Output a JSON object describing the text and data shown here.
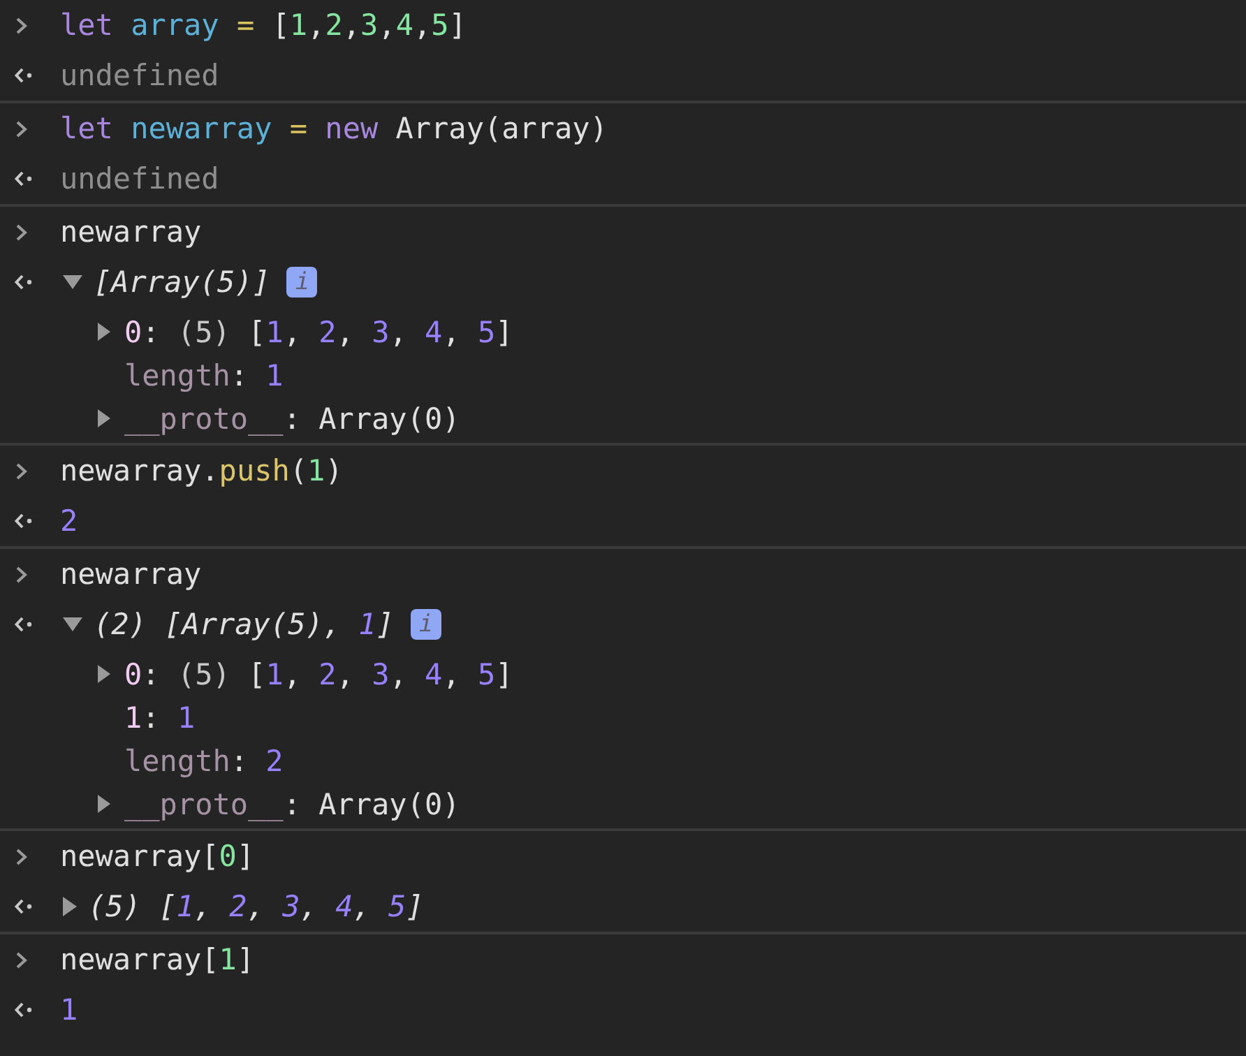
{
  "entries": [
    {
      "input": [
        {
          "t": "let ",
          "kind": "kw"
        },
        {
          "t": "array ",
          "kind": "var"
        },
        {
          "t": "=",
          "kind": "op"
        },
        {
          "t": " [",
          "kind": "plain"
        },
        {
          "t": "1",
          "kind": "lit"
        },
        {
          "t": ",",
          "kind": "plain"
        },
        {
          "t": "2",
          "kind": "lit"
        },
        {
          "t": ",",
          "kind": "plain"
        },
        {
          "t": "3",
          "kind": "lit"
        },
        {
          "t": ",",
          "kind": "plain"
        },
        {
          "t": "4",
          "kind": "lit"
        },
        {
          "t": ",",
          "kind": "plain"
        },
        {
          "t": "5",
          "kind": "lit"
        },
        {
          "t": "]",
          "kind": "plain"
        }
      ],
      "output": {
        "kind": "value",
        "segments": [
          {
            "t": "undefined",
            "kind": "undef"
          }
        ]
      }
    },
    {
      "input": [
        {
          "t": "let ",
          "kind": "kw"
        },
        {
          "t": "newarray ",
          "kind": "var"
        },
        {
          "t": "= ",
          "kind": "op"
        },
        {
          "t": "new",
          "kind": "kw"
        },
        {
          "t": " Array(array)",
          "kind": "plain"
        }
      ],
      "output": {
        "kind": "value",
        "segments": [
          {
            "t": "undefined",
            "kind": "undef"
          }
        ]
      }
    },
    {
      "input": [
        {
          "t": "newarray",
          "kind": "plain"
        }
      ],
      "output": {
        "kind": "object",
        "expanded": true,
        "summary": [
          {
            "t": "[Array(5)]",
            "kind": "plain"
          }
        ],
        "info_badge": "i",
        "children": [
          {
            "expandable": true,
            "segments": [
              {
                "t": "0",
                "kind": "key"
              },
              {
                "t": ": ",
                "kind": "plain"
              },
              {
                "t": "(5) ",
                "kind": "dim"
              },
              {
                "t": "[",
                "kind": "plain"
              },
              {
                "t": "1",
                "kind": "num"
              },
              {
                "t": ", ",
                "kind": "plain"
              },
              {
                "t": "2",
                "kind": "num"
              },
              {
                "t": ", ",
                "kind": "plain"
              },
              {
                "t": "3",
                "kind": "num"
              },
              {
                "t": ", ",
                "kind": "plain"
              },
              {
                "t": "4",
                "kind": "num"
              },
              {
                "t": ", ",
                "kind": "plain"
              },
              {
                "t": "5",
                "kind": "num"
              },
              {
                "t": "]",
                "kind": "plain"
              }
            ]
          },
          {
            "expandable": false,
            "segments": [
              {
                "t": "length",
                "kind": "internal"
              },
              {
                "t": ": ",
                "kind": "plain"
              },
              {
                "t": "1",
                "kind": "num"
              }
            ]
          },
          {
            "expandable": true,
            "segments": [
              {
                "t": "__proto__",
                "kind": "internal"
              },
              {
                "t": ": Array(0)",
                "kind": "plain"
              }
            ]
          }
        ]
      }
    },
    {
      "input": [
        {
          "t": "newarray.",
          "kind": "plain"
        },
        {
          "t": "push",
          "kind": "method"
        },
        {
          "t": "(",
          "kind": "plain"
        },
        {
          "t": "1",
          "kind": "lit"
        },
        {
          "t": ")",
          "kind": "plain"
        }
      ],
      "output": {
        "kind": "value",
        "segments": [
          {
            "t": "2",
            "kind": "num"
          }
        ]
      }
    },
    {
      "input": [
        {
          "t": "newarray",
          "kind": "plain"
        }
      ],
      "output": {
        "kind": "object",
        "expanded": true,
        "summary": [
          {
            "t": "(2) [Array(5), ",
            "kind": "plain"
          },
          {
            "t": "1",
            "kind": "num"
          },
          {
            "t": "]",
            "kind": "plain"
          }
        ],
        "info_badge": "i",
        "children": [
          {
            "expandable": true,
            "segments": [
              {
                "t": "0",
                "kind": "key"
              },
              {
                "t": ": ",
                "kind": "plain"
              },
              {
                "t": "(5) ",
                "kind": "dim"
              },
              {
                "t": "[",
                "kind": "plain"
              },
              {
                "t": "1",
                "kind": "num"
              },
              {
                "t": ", ",
                "kind": "plain"
              },
              {
                "t": "2",
                "kind": "num"
              },
              {
                "t": ", ",
                "kind": "plain"
              },
              {
                "t": "3",
                "kind": "num"
              },
              {
                "t": ", ",
                "kind": "plain"
              },
              {
                "t": "4",
                "kind": "num"
              },
              {
                "t": ", ",
                "kind": "plain"
              },
              {
                "t": "5",
                "kind": "num"
              },
              {
                "t": "]",
                "kind": "plain"
              }
            ]
          },
          {
            "expandable": false,
            "segments": [
              {
                "t": "1",
                "kind": "key"
              },
              {
                "t": ": ",
                "kind": "plain"
              },
              {
                "t": "1",
                "kind": "num"
              }
            ]
          },
          {
            "expandable": false,
            "segments": [
              {
                "t": "length",
                "kind": "internal"
              },
              {
                "t": ": ",
                "kind": "plain"
              },
              {
                "t": "2",
                "kind": "num"
              }
            ]
          },
          {
            "expandable": true,
            "segments": [
              {
                "t": "__proto__",
                "kind": "internal"
              },
              {
                "t": ": Array(0)",
                "kind": "plain"
              }
            ]
          }
        ]
      }
    },
    {
      "input": [
        {
          "t": "newarray[",
          "kind": "plain"
        },
        {
          "t": "0",
          "kind": "lit"
        },
        {
          "t": "]",
          "kind": "plain"
        }
      ],
      "output": {
        "kind": "object",
        "expanded": false,
        "summary": [
          {
            "t": "(5) [",
            "kind": "plain"
          },
          {
            "t": "1",
            "kind": "num"
          },
          {
            "t": ", ",
            "kind": "plain"
          },
          {
            "t": "2",
            "kind": "num"
          },
          {
            "t": ", ",
            "kind": "plain"
          },
          {
            "t": "3",
            "kind": "num"
          },
          {
            "t": ", ",
            "kind": "plain"
          },
          {
            "t": "4",
            "kind": "num"
          },
          {
            "t": ", ",
            "kind": "plain"
          },
          {
            "t": "5",
            "kind": "num"
          },
          {
            "t": "]",
            "kind": "plain"
          }
        ]
      }
    },
    {
      "input": [
        {
          "t": "newarray[",
          "kind": "plain"
        },
        {
          "t": "1",
          "kind": "lit"
        },
        {
          "t": "]",
          "kind": "plain"
        }
      ],
      "output": {
        "kind": "value",
        "segments": [
          {
            "t": "1",
            "kind": "num"
          }
        ]
      }
    }
  ]
}
